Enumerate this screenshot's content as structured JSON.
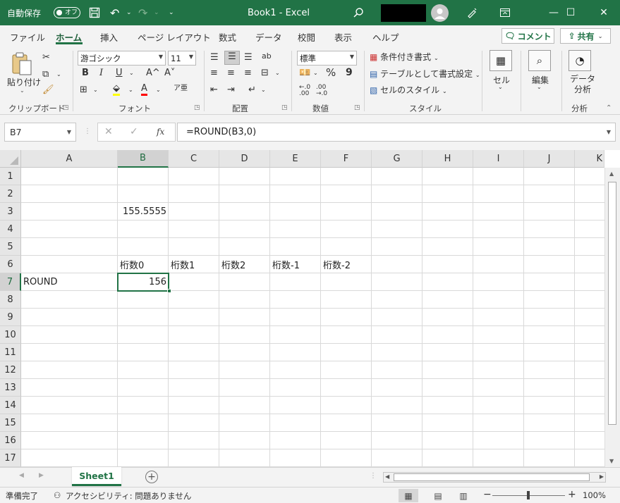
{
  "titlebar": {
    "autosave_label": "自動保存",
    "autosave_state": "オフ",
    "document_title": "Book1  -  Excel",
    "undo_glyph": "↶",
    "redo_glyph": "↷",
    "dropdown_glyph": "⌄",
    "minimize_glyph": "—",
    "maximize_glyph": "☐",
    "close_glyph": "✕"
  },
  "tabs": [
    "ファイル",
    "ホーム",
    "挿入",
    "ページ レイアウト",
    "数式",
    "データ",
    "校閲",
    "表示",
    "ヘルプ"
  ],
  "active_tab": "ホーム",
  "comment_button": "コメント",
  "share_button": "共有",
  "ribbon": {
    "clipboard": {
      "label": "クリップボード",
      "paste": "貼り付け"
    },
    "font": {
      "label": "フォント",
      "font_name": "游ゴシック",
      "font_size": "11",
      "bold": "B",
      "italic": "I",
      "underline": "U",
      "grow": "A^",
      "shrink": "A˅"
    },
    "alignment": {
      "label": "配置"
    },
    "number": {
      "label": "数値",
      "format": "標準",
      "percent": "%",
      "comma": "9"
    },
    "styles": {
      "label": "スタイル",
      "conditional": "条件付き書式",
      "table": "テーブルとして書式設定",
      "cell_styles": "セルのスタイル"
    },
    "cells": {
      "label": "セル"
    },
    "editing": {
      "label": "編集"
    },
    "analysis": {
      "label": "分析",
      "button": "データ\n分析"
    }
  },
  "formula_bar": {
    "name_box": "B7",
    "formula": "=ROUND(B3,0)",
    "fx": "fx"
  },
  "columns": [
    "A",
    "B",
    "C",
    "D",
    "E",
    "F",
    "G",
    "H",
    "I",
    "J",
    "K"
  ],
  "selected_column": "B",
  "rows": [
    "1",
    "2",
    "3",
    "4",
    "5",
    "6",
    "7",
    "8",
    "9",
    "10",
    "11",
    "12",
    "13",
    "14",
    "15",
    "16",
    "17"
  ],
  "selected_row": "7",
  "cells": {
    "B3": "155.5555",
    "B6": "桁数0",
    "C6": "桁数1",
    "D6": "桁数2",
    "E6": "桁数-1",
    "F6": "桁数-2",
    "A7": "ROUND",
    "B7": "156"
  },
  "sheets": [
    "Sheet1"
  ],
  "active_sheet": "Sheet1",
  "statusbar": {
    "ready": "準備完了",
    "accessibility": "アクセシビリティ: 問題ありません",
    "zoom": "100%"
  },
  "colors": {
    "accent": "#217346"
  }
}
